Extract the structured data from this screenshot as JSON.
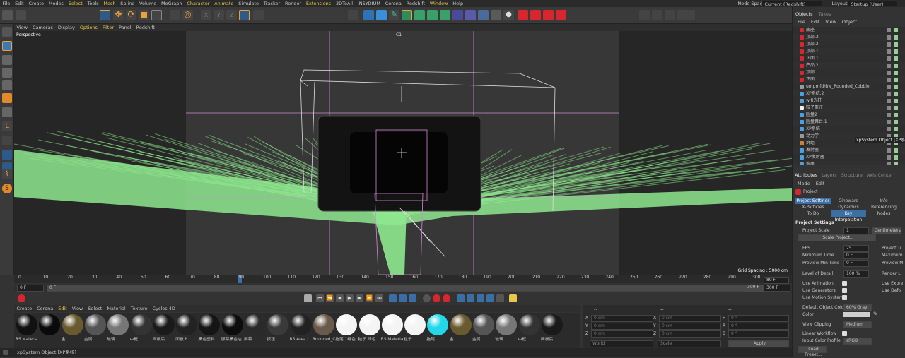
{
  "menu": {
    "items": [
      "File",
      "Edit",
      "Create",
      "Modes",
      "Select",
      "Tools",
      "Mesh",
      "Spline",
      "Volume",
      "MoGraph",
      "Character",
      "Animate",
      "Simulate",
      "Tracker",
      "Render",
      "Extensions",
      "3DToAll",
      "INSYDIUM",
      "Corona",
      "Redshift",
      "Window",
      "Help"
    ],
    "highlighted": [
      "Select",
      "Mesh",
      "Character",
      "Animate",
      "Extensions",
      "Window"
    ],
    "node_space_label": "Node Space:",
    "node_space_value": "Current (Redshift)",
    "layout_label": "Layout:",
    "layout_value": "Startup (User)"
  },
  "viewport": {
    "menu": [
      "View",
      "Cameras",
      "Display",
      "Options",
      "Filter",
      "Panel",
      "Redshift"
    ],
    "highlighted": [
      "Options",
      "Filter"
    ],
    "name": "Perspective",
    "grid_spacing": "Grid Spacing : 5000 cm",
    "camera_label": "C1"
  },
  "timeline": {
    "ticks": [
      "0",
      "10",
      "20",
      "30",
      "40",
      "50",
      "60",
      "70",
      "80",
      "90",
      "100",
      "110",
      "120",
      "130",
      "140",
      "150",
      "160",
      "170",
      "180",
      "190",
      "200",
      "210",
      "220",
      "230",
      "240",
      "250",
      "260",
      "270",
      "280",
      "290",
      "300"
    ],
    "current_frame": 89,
    "start_field": "0 F",
    "start_field2": "0 F",
    "end_field": "300 F",
    "end_field2": "300 F",
    "current_field": "89 F"
  },
  "materials": {
    "menu": [
      "Create",
      "Corona",
      "Edit",
      "View",
      "Select",
      "Material",
      "Texture",
      "Cycles 4D"
    ],
    "highlighted": [
      "Edit"
    ],
    "items": [
      {
        "label": "RS Materia",
        "color": "#111"
      },
      {
        "label": "",
        "color": "#0a0a0a"
      },
      {
        "label": "金",
        "color": "#6a5a30"
      },
      {
        "label": "金属",
        "color": "#555"
      },
      {
        "label": "玻璃",
        "color": "#777"
      },
      {
        "label": "中框",
        "color": "#333"
      },
      {
        "label": "面板后",
        "color": "#1a1a1a"
      },
      {
        "label": "面板上",
        "color": "#222"
      },
      {
        "label": "黑色塑料",
        "color": "#151515"
      },
      {
        "label": "屏幕黑色边",
        "color": "#0d0d0d"
      },
      {
        "label": "屏幕",
        "color": "#2a2a2a"
      },
      {
        "label": "按钮",
        "color": "#3a3a3a"
      },
      {
        "label": "RS Area Li",
        "color": "#222"
      },
      {
        "label": "Rounded_C",
        "color": "#6a5a4a"
      },
      {
        "label": "拖尾.1绿色",
        "color": "#f4f4f4"
      },
      {
        "label": "粒子 绿色",
        "color": "#f4f4f4"
      },
      {
        "label": "RS Materia",
        "color": "#f4f4f4"
      },
      {
        "label": "粒子",
        "color": "#f4f4f4"
      },
      {
        "label": "拖尾",
        "color": "#22d8e8"
      },
      {
        "label": "金",
        "color": "#6a5a30"
      },
      {
        "label": "金属",
        "color": "#555"
      },
      {
        "label": "玻璃",
        "color": "#777"
      },
      {
        "label": "中框",
        "color": "#333"
      },
      {
        "label": "面板后",
        "color": "#1a1a1a"
      }
    ]
  },
  "coords": {
    "rows": [
      {
        "axis": "X",
        "pos": "0 cm",
        "axis2": "X",
        "size": "0 cm",
        "axis3": "H",
        "rot": "0 °"
      },
      {
        "axis": "Y",
        "pos": "0 cm",
        "axis2": "Y",
        "size": "0 cm",
        "axis3": "P",
        "rot": "0 °"
      },
      {
        "axis": "Z",
        "pos": "0 cm",
        "axis2": "Z",
        "size": "0 cm",
        "axis3": "B",
        "rot": "0 °"
      }
    ],
    "world": "World",
    "scale": "Scale",
    "apply": "Apply",
    "top_left": "--",
    "top_mid": "--",
    "top_right": "--"
  },
  "status": {
    "text": "xpSystem Object [XP系统]"
  },
  "objects": {
    "tabs": [
      "Objects",
      "Takes"
    ],
    "menu": [
      "File",
      "Edit",
      "View",
      "Object"
    ],
    "items": [
      {
        "name": "底座",
        "color": "#d8262e"
      },
      {
        "name": "顶部.3",
        "color": "#d8262e"
      },
      {
        "name": "顶部.2",
        "color": "#d8262e"
      },
      {
        "name": "顶部.1",
        "color": "#d8262e"
      },
      {
        "name": "正面.1",
        "color": "#d8262e"
      },
      {
        "name": "产品.2",
        "color": "#d8262e"
      },
      {
        "name": "顶部",
        "color": "#d8262e"
      },
      {
        "name": "正面",
        "color": "#d8262e"
      },
      {
        "name": "umpmfd/Bw_Rounded_Cobble",
        "color": "#9a9a9a"
      },
      {
        "name": "XP系统.2",
        "color": "#4aa0e0"
      },
      {
        "name": "wifi光柱",
        "color": "#4aa0e0"
      },
      {
        "name": "粒子重注",
        "color": "#eee"
      },
      {
        "name": "圆盘2",
        "color": "#4aa0e0"
      },
      {
        "name": "圆盘舞台.1",
        "color": "#4aa0e0"
      },
      {
        "name": "XP系统",
        "color": "#4aa0e0"
      },
      {
        "name": "动力学",
        "color": "#9a9a9a"
      },
      {
        "name": "群组",
        "color": "#d08030"
      },
      {
        "name": "发射器",
        "color": "#4aa0e0"
      },
      {
        "name": "XP发射器",
        "color": "#4aa0e0"
      },
      {
        "name": "拖尾",
        "color": "#4aa0e0"
      }
    ],
    "tooltip": "xpSystem Object [XP系统]"
  },
  "attributes": {
    "tabs": [
      "Attributes",
      "Layers",
      "Structure",
      "Axis Center"
    ],
    "menu": [
      "Mode",
      "Edit"
    ],
    "object": "Project",
    "subtabs": [
      [
        "Project Settings",
        "Cineware",
        "Info"
      ],
      [
        "X-Particles",
        "Dynamics",
        "Referencing"
      ],
      [
        "To Do",
        "Key Interpolation",
        "Nodes"
      ]
    ],
    "section": "Project Settings",
    "project_scale_label": "Project Scale",
    "project_scale_value": "1",
    "project_scale_unit": "Centimeters",
    "scale_project_btn": "Scale Project...",
    "fps_label": "FPS",
    "fps_value": "25",
    "project_time_label": "Project Ti",
    "min_time_label": "Minimum Time",
    "min_time_value": "0 F",
    "max_label": "Maximum",
    "preview_min_label": "Preview Min Time",
    "preview_min_value": "0 F",
    "preview_max_label": "Preview M",
    "lod_label": "Level of Detail",
    "lod_value": "100 %",
    "render_lod_label": "Render L",
    "use_animation": "Use Animation",
    "use_expr": "Use Expre",
    "use_generators": "Use Generators",
    "use_deformers": "Use Defo",
    "use_motion": "Use Motion System",
    "default_color_label": "Default Object Color",
    "default_color_value": "60% Gray",
    "color_label": "Color",
    "view_clipping_label": "View Clipping",
    "view_clipping_value": "Medium",
    "linear_workflow": "Linear Workflow",
    "input_profile_label": "Input Color Profile",
    "input_profile_value": "sRGB",
    "load_preset": "Load Preset..."
  }
}
